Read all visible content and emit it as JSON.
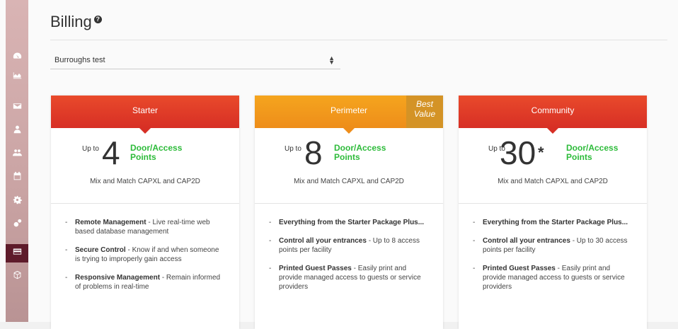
{
  "page": {
    "title": "Billing"
  },
  "sidebar": {
    "items": [
      {
        "icon": "dashboard-icon"
      },
      {
        "icon": "area-chart-icon"
      },
      {
        "icon": "envelope-icon"
      },
      {
        "icon": "user-icon"
      },
      {
        "icon": "users-icon"
      },
      {
        "icon": "calendar-icon"
      },
      {
        "icon": "gear-icon"
      },
      {
        "icon": "gears-icon"
      },
      {
        "icon": "credit-card-icon",
        "active": true
      },
      {
        "icon": "cube-icon"
      }
    ]
  },
  "site_select": {
    "value": "Burroughs test"
  },
  "plans": [
    {
      "name": "Starter",
      "best_label": "",
      "upto": "Up to",
      "count": "4",
      "asterisk": "",
      "unit_line1": "Door/Access",
      "unit_line2": "Points",
      "mix": "Mix and Match CAPXL and CAP2D",
      "features": [
        {
          "bold": "Remote Management",
          "text": " - Live real-time web based database management"
        },
        {
          "bold": "Secure Control",
          "text": " - Know if and when someone is trying to improperly gain access"
        },
        {
          "bold": "Responsive Management",
          "text": " - Remain informed of problems in real-time"
        }
      ]
    },
    {
      "name": "Perimeter",
      "best_label": "Best Value",
      "upto": "Up to",
      "count": "8",
      "asterisk": "",
      "unit_line1": "Door/Access",
      "unit_line2": "Points",
      "mix": "Mix and Match CAPXL and CAP2D",
      "features": [
        {
          "bold": "Everything from the Starter Package Plus...",
          "text": ""
        },
        {
          "bold": "Control all your entrances",
          "text": " - Up to 8 access points per facility"
        },
        {
          "bold": "Printed Guest Passes",
          "text": " - Easily print and provide managed access to guests or service providers"
        }
      ]
    },
    {
      "name": "Community",
      "best_label": "",
      "upto": "Up to",
      "count": "30",
      "asterisk": "*",
      "unit_line1": "Door/Access",
      "unit_line2": "Points",
      "mix": "Mix and Match CAPXL and CAP2D",
      "features": [
        {
          "bold": "Everything from the Starter Package Plus...",
          "text": ""
        },
        {
          "bold": "Control all your entrances",
          "text": " - Up to 30 access points per facility"
        },
        {
          "bold": "Printed Guest Passes",
          "text": " - Easily print and provide managed access to guests or service providers"
        }
      ]
    }
  ],
  "colors": {
    "accent_green": "#2dbb3a",
    "starter_header": "#d72f25",
    "perimeter_header": "#ee8d1a",
    "best_badge": "#d49326",
    "sidebar_active": "#5e1b2a"
  }
}
